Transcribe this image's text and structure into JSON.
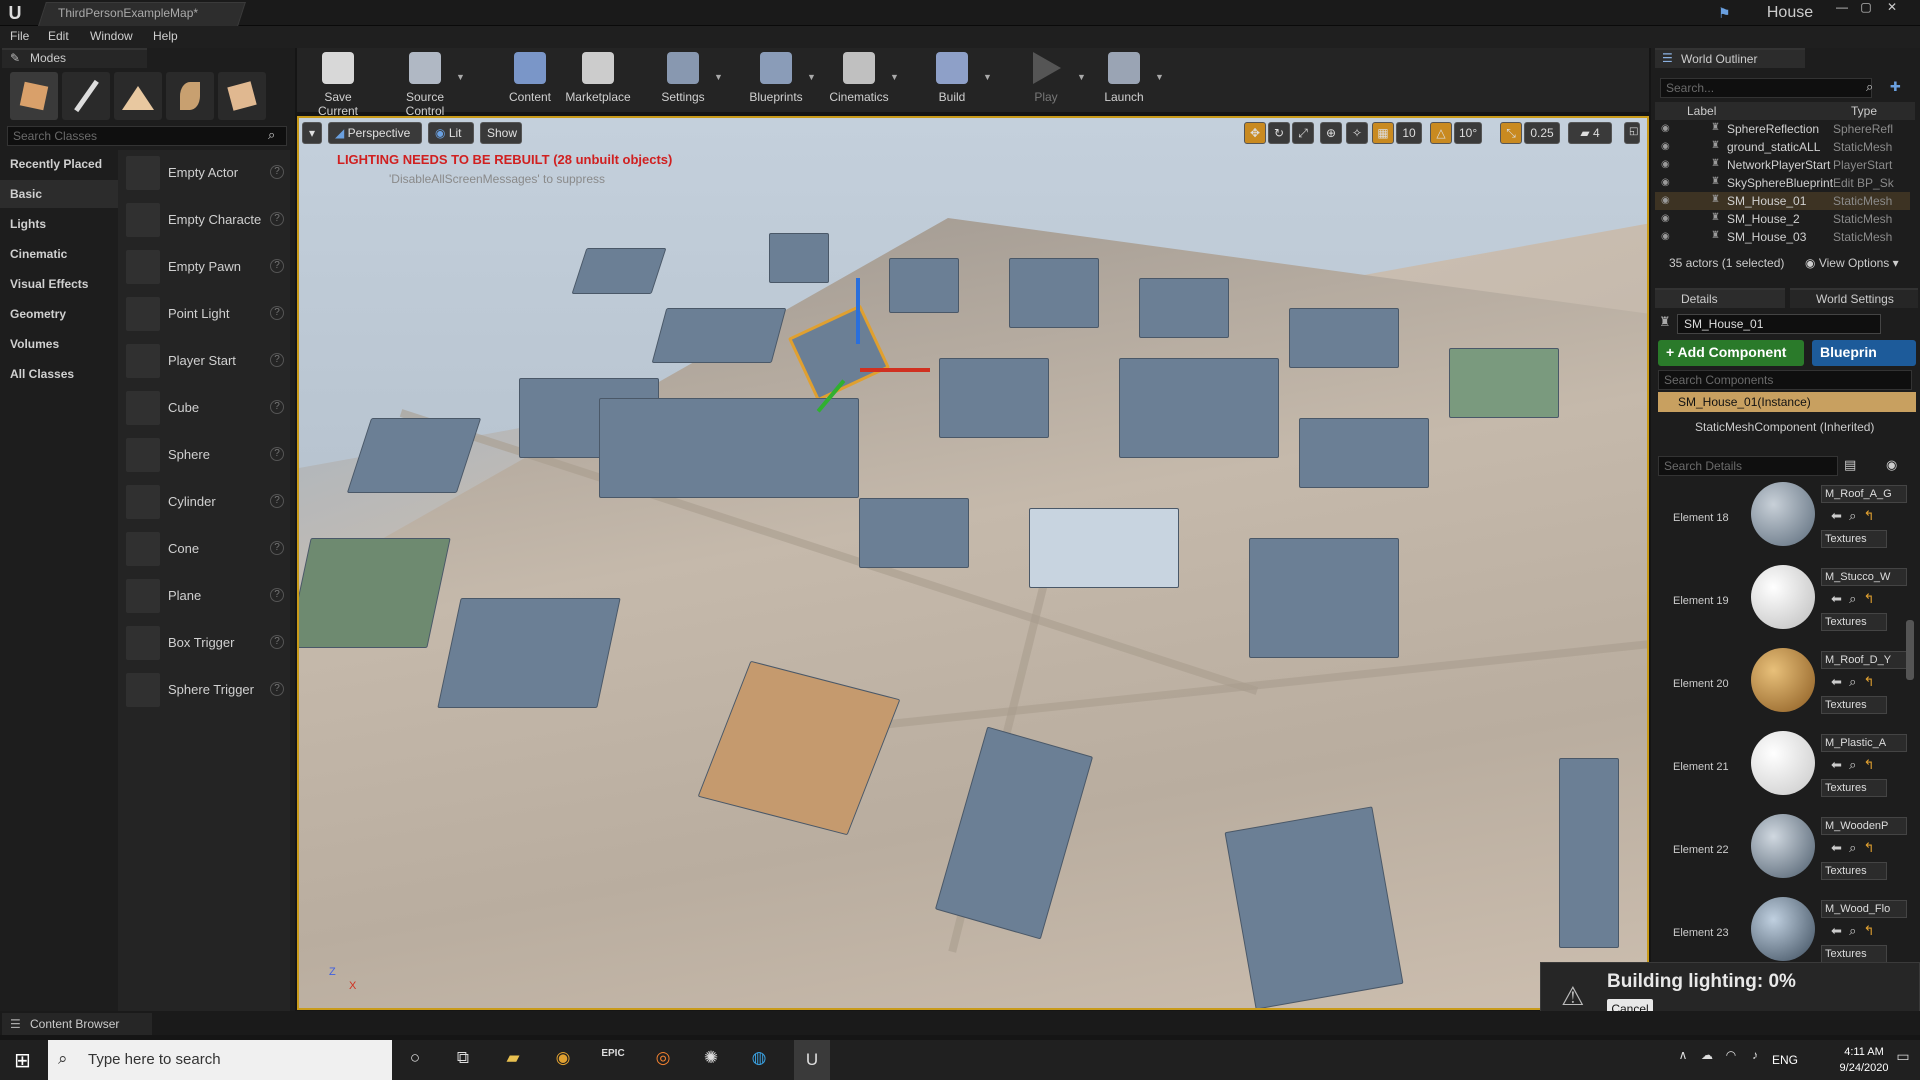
{
  "window": {
    "doc_tab": "ThirdPersonExampleMap*",
    "project": "House"
  },
  "menu": [
    "File",
    "Edit",
    "Window",
    "Help"
  ],
  "modes": {
    "tab_label": "Modes",
    "search_placeholder": "Search Classes",
    "categories": [
      "Recently Placed",
      "Basic",
      "Lights",
      "Cinematic",
      "Visual Effects",
      "Geometry",
      "Volumes",
      "All Classes"
    ],
    "items": [
      "Empty Actor",
      "Empty Characte",
      "Empty Pawn",
      "Point Light",
      "Player Start",
      "Cube",
      "Sphere",
      "Cylinder",
      "Cone",
      "Plane",
      "Box Trigger",
      "Sphere Trigger"
    ]
  },
  "toolbar": {
    "save": "Save Current",
    "source": "Source Control",
    "content": "Content",
    "marketplace": "Marketplace",
    "settings": "Settings",
    "blueprints": "Blueprints",
    "cinematics": "Cinematics",
    "build": "Build",
    "play": "Play",
    "launch": "Launch"
  },
  "viewport": {
    "perspective": "Perspective",
    "lit": "Lit",
    "show": "Show",
    "warning": "LIGHTING NEEDS TO BE REBUILT (28 unbuilt objects)",
    "suppress": "'DisableAllScreenMessages' to suppress",
    "grid_snap": "10",
    "rot_snap": "10°",
    "scale_snap": "0.25",
    "cam_speed": "4",
    "axis_z": "Z",
    "axis_x": "X"
  },
  "outliner": {
    "tab": "World Outliner",
    "search_placeholder": "Search...",
    "col_label": "Label",
    "col_type": "Type",
    "rows": [
      {
        "name": "SphereReflection",
        "type": "SphereRefl"
      },
      {
        "name": "ground_staticALL",
        "type": "StaticMesh"
      },
      {
        "name": "NetworkPlayerStart",
        "type": "PlayerStart"
      },
      {
        "name": "SkySphereBlueprint",
        "type": "Edit BP_Sk"
      },
      {
        "name": "SM_House_01",
        "type": "StaticMesh"
      },
      {
        "name": "SM_House_2",
        "type": "StaticMesh"
      },
      {
        "name": "SM_House_03",
        "type": "StaticMesh"
      }
    ],
    "footer": "35 actors (1 selected)",
    "view_options": "View Options"
  },
  "details": {
    "tab": "Details",
    "tab2": "World Settings",
    "name": "SM_House_01",
    "add_component": "+ Add Component",
    "blueprint": "Blueprin",
    "search_components": "Search Components",
    "instance": "SM_House_01(Instance)",
    "inherited": "StaticMeshComponent (Inherited)",
    "search_details": "Search Details",
    "elements": [
      {
        "label": "Element 18",
        "name": "M_Roof_A_G",
        "tex": "Textures"
      },
      {
        "label": "Element 19",
        "name": "M_Stucco_W",
        "tex": "Textures"
      },
      {
        "label": "Element 20",
        "name": "M_Roof_D_Y",
        "tex": "Textures"
      },
      {
        "label": "Element 21",
        "name": "M_Plastic_A",
        "tex": "Textures"
      },
      {
        "label": "Element 22",
        "name": "M_WoodenP",
        "tex": "Textures"
      },
      {
        "label": "Element 23",
        "name": "M_Wood_Flo",
        "tex": "Textures"
      }
    ]
  },
  "toast": {
    "text": "Building lighting:  0%",
    "cancel": "Cancel"
  },
  "content_browser": "Content Browser",
  "taskbar": {
    "search": "Type here to search",
    "lang": "ENG",
    "time": "4:11 AM",
    "date": "9/24/2020"
  }
}
